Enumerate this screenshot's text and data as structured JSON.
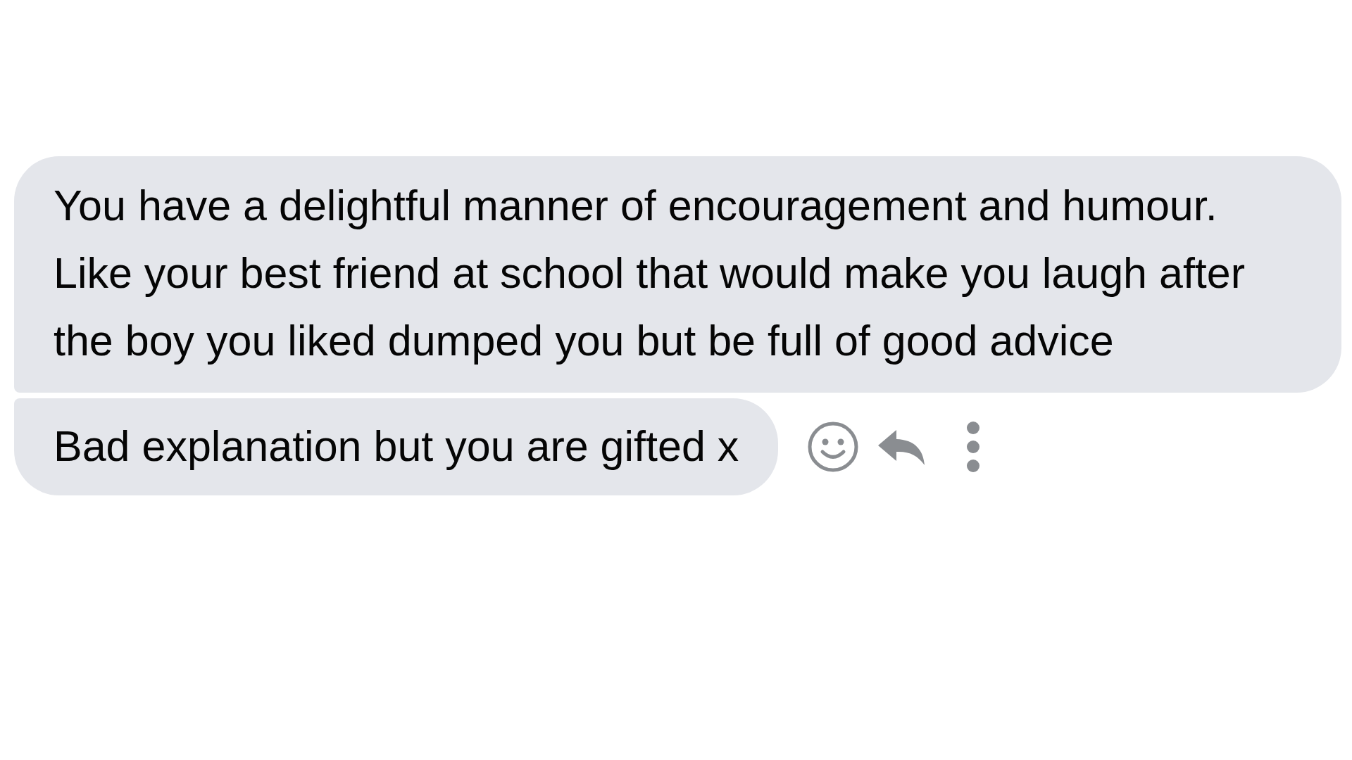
{
  "messages": [
    {
      "text": "You have a delightful manner of encouragement and humour.  Like your best friend at school that would make you laugh after the boy you liked dumped you but be full of good advice"
    },
    {
      "text": "Bad explanation but you are gifted x"
    }
  ]
}
